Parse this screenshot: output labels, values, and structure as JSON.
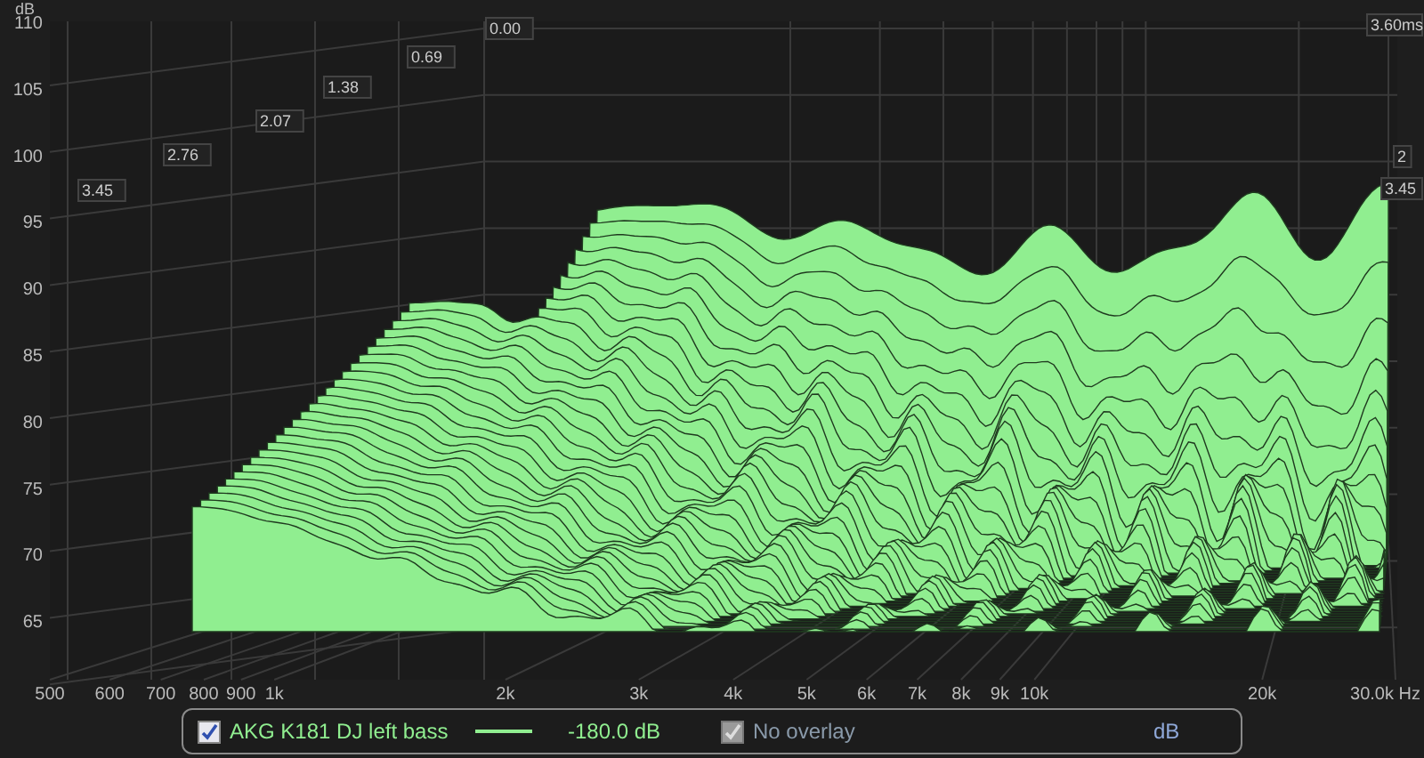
{
  "chart": {
    "y_unit": "dB",
    "y_ticks": [
      "110",
      "105",
      "100",
      "95",
      "90",
      "85",
      "80",
      "75",
      "70",
      "65"
    ],
    "x_ticks": [
      "500",
      "600",
      "700",
      "800",
      "900",
      "1k",
      "2k",
      "3k",
      "4k",
      "5k",
      "6k",
      "7k",
      "8k",
      "9k",
      "10k",
      "20k",
      "30.0k Hz"
    ],
    "time_ticks": [
      "0.00",
      "0.69",
      "1.38",
      "2.07",
      "2.76",
      "3.45"
    ],
    "right_time_ticks": [
      "3.60ms",
      "2",
      "3.45"
    ]
  },
  "legend": {
    "series": {
      "name": "AKG K181 DJ left bass",
      "checked": true,
      "color": "#90ee90",
      "reading": "-180.0 dB"
    },
    "overlay": {
      "name": "No overlay",
      "checked": true,
      "disabled": true
    },
    "unit": "dB"
  }
}
